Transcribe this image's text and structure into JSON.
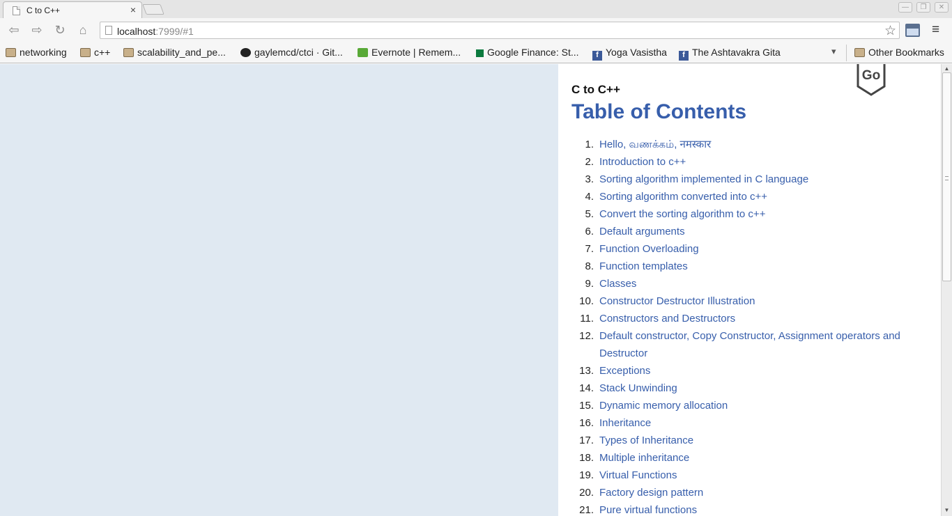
{
  "browser": {
    "tab_title": "C to C++",
    "tab_close": "×",
    "url_host": "localhost",
    "url_rest": ":7999/#1"
  },
  "bookmarks": [
    {
      "label": "networking",
      "icon": "folder-icon"
    },
    {
      "label": "c++",
      "icon": "folder-icon"
    },
    {
      "label": "scalability_and_pe...",
      "icon": "folder-icon"
    },
    {
      "label": "gaylemcd/ctci · Git...",
      "icon": "github-icon"
    },
    {
      "label": "Evernote | Remem...",
      "icon": "evernote-icon"
    },
    {
      "label": "Google Finance: St...",
      "icon": "google-finance-icon"
    },
    {
      "label": "Yoga Vasistha",
      "icon": "facebook-icon"
    },
    {
      "label": "The Ashtavakra Gita",
      "icon": "facebook-icon"
    }
  ],
  "other_bookmarks": "Other Bookmarks",
  "page": {
    "badge": "Go",
    "doc_title": "C to C++",
    "toc_heading": "Table of Contents",
    "toc": [
      {
        "num": "1.",
        "label": "Hello, வணக்கம், नमस्कार"
      },
      {
        "num": "2.",
        "label": "Introduction to c++"
      },
      {
        "num": "3.",
        "label": "Sorting algorithm implemented in C language"
      },
      {
        "num": "4.",
        "label": "Sorting algorithm converted into c++"
      },
      {
        "num": "5.",
        "label": "Convert the sorting algorithm to c++"
      },
      {
        "num": "6.",
        "label": "Default arguments"
      },
      {
        "num": "7.",
        "label": "Function Overloading"
      },
      {
        "num": "8.",
        "label": "Function templates"
      },
      {
        "num": "9.",
        "label": "Classes"
      },
      {
        "num": "10.",
        "label": "Constructor Destructor Illustration"
      },
      {
        "num": "11.",
        "label": "Constructors and Destructors"
      },
      {
        "num": "12.",
        "label": "Default constructor, Copy Constructor, Assignment operators and Destructor"
      },
      {
        "num": "13.",
        "label": "Exceptions"
      },
      {
        "num": "14.",
        "label": "Stack Unwinding"
      },
      {
        "num": "15.",
        "label": "Dynamic memory allocation"
      },
      {
        "num": "16.",
        "label": "Inheritance"
      },
      {
        "num": "17.",
        "label": "Types of Inheritance"
      },
      {
        "num": "18.",
        "label": "Multiple inheritance"
      },
      {
        "num": "19.",
        "label": "Virtual Functions"
      },
      {
        "num": "20.",
        "label": "Factory design pattern"
      },
      {
        "num": "21.",
        "label": "Pure virtual functions"
      }
    ]
  },
  "colors": {
    "link": "#375eab",
    "left_pane_bg": "#e0e9f2"
  }
}
